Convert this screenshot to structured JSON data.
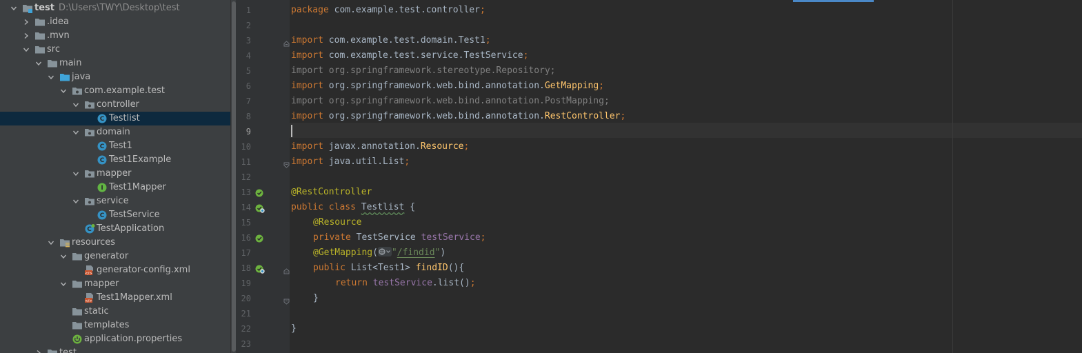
{
  "project": {
    "root": {
      "name": "test",
      "path": "D:\\Users\\TWY\\Desktop\\test"
    },
    "items": [
      {
        "label": ".idea"
      },
      {
        "label": ".mvn"
      },
      {
        "label": "src"
      },
      {
        "label": "main"
      },
      {
        "label": "java"
      },
      {
        "label": "com.example.test"
      },
      {
        "label": "controller"
      },
      {
        "label": "Testlist"
      },
      {
        "label": "domain"
      },
      {
        "label": "Test1"
      },
      {
        "label": "Test1Example"
      },
      {
        "label": "mapper"
      },
      {
        "label": "Test1Mapper"
      },
      {
        "label": "service"
      },
      {
        "label": "TestService"
      },
      {
        "label": "TestApplication"
      },
      {
        "label": "resources"
      },
      {
        "label": "generator"
      },
      {
        "label": "generator-config.xml"
      },
      {
        "label": "mapper"
      },
      {
        "label": "Test1Mapper.xml"
      },
      {
        "label": "static"
      },
      {
        "label": "templates"
      },
      {
        "label": "application.properties"
      },
      {
        "label": "test"
      }
    ]
  },
  "editor": {
    "line_numbers": [
      "1",
      "2",
      "3",
      "4",
      "5",
      "6",
      "7",
      "8",
      "9",
      "10",
      "11",
      "12",
      "13",
      "14",
      "15",
      "16",
      "17",
      "18",
      "19",
      "20",
      "21",
      "22",
      "23"
    ],
    "current_line": "9",
    "lines": {
      "l1": {
        "kw": "package",
        "text": " com.example.test.controller",
        "semi": ";"
      },
      "l3": {
        "kw": "import",
        "text": " com.example.test.domain.Test1",
        "semi": ";"
      },
      "l4": {
        "kw": "import",
        "text": " com.example.test.service.TestService",
        "semi": ";"
      },
      "l5": {
        "text": "import org.springframework.stereotype.Repository;"
      },
      "l6": {
        "kw": "import",
        "text": " org.springframework.web.bind.annotation.",
        "cls": "GetMapping",
        "semi": ";"
      },
      "l7": {
        "text": "import org.springframework.web.bind.annotation.PostMapping;"
      },
      "l8": {
        "kw": "import",
        "text": " org.springframework.web.bind.annotation.",
        "cls": "RestController",
        "semi": ";"
      },
      "l10": {
        "kw": "import",
        "text": " javax.annotation.",
        "cls": "Resource",
        "semi": ";"
      },
      "l11": {
        "kw": "import",
        "text": " java.util.List",
        "semi": ";"
      },
      "l13": {
        "ann": "@RestController"
      },
      "l14": {
        "kw": "public class",
        "name": "Testlist",
        "rest": " {"
      },
      "l15": {
        "ann": "@Resource"
      },
      "l16": {
        "kw": "private",
        "type": " TestService ",
        "field": "testService",
        "semi": ";"
      },
      "l17": {
        "ann": "@GetMapping",
        "open": "(",
        "q1": "\"",
        "path": "/findid",
        "q2": "\"",
        "close": ")"
      },
      "l18": {
        "kw": "public",
        "type": " List<Test1> ",
        "method": "findID",
        "rest": "(){"
      },
      "l19": {
        "kw": "return",
        "field": "testService",
        "rest": ".list()",
        "semi": ";"
      },
      "l20": {
        "text": "}"
      },
      "l22": {
        "text": "}"
      }
    }
  },
  "colors": {
    "keyword": "#cc7832",
    "annotation": "#bbb529",
    "string": "#6a8759",
    "field": "#9876aa",
    "method": "#ffc66d",
    "unused": "#808080",
    "text": "#a9b7c6",
    "selection": "#0d293e"
  },
  "icons": {
    "folder": "folder-icon",
    "package": "package-icon",
    "class": "class-icon",
    "interface": "interface-icon",
    "spring_app": "spring-boot-app-icon",
    "xml": "xml-file-icon",
    "properties": "spring-properties-icon",
    "bean": "spring-bean-gutter-icon"
  }
}
